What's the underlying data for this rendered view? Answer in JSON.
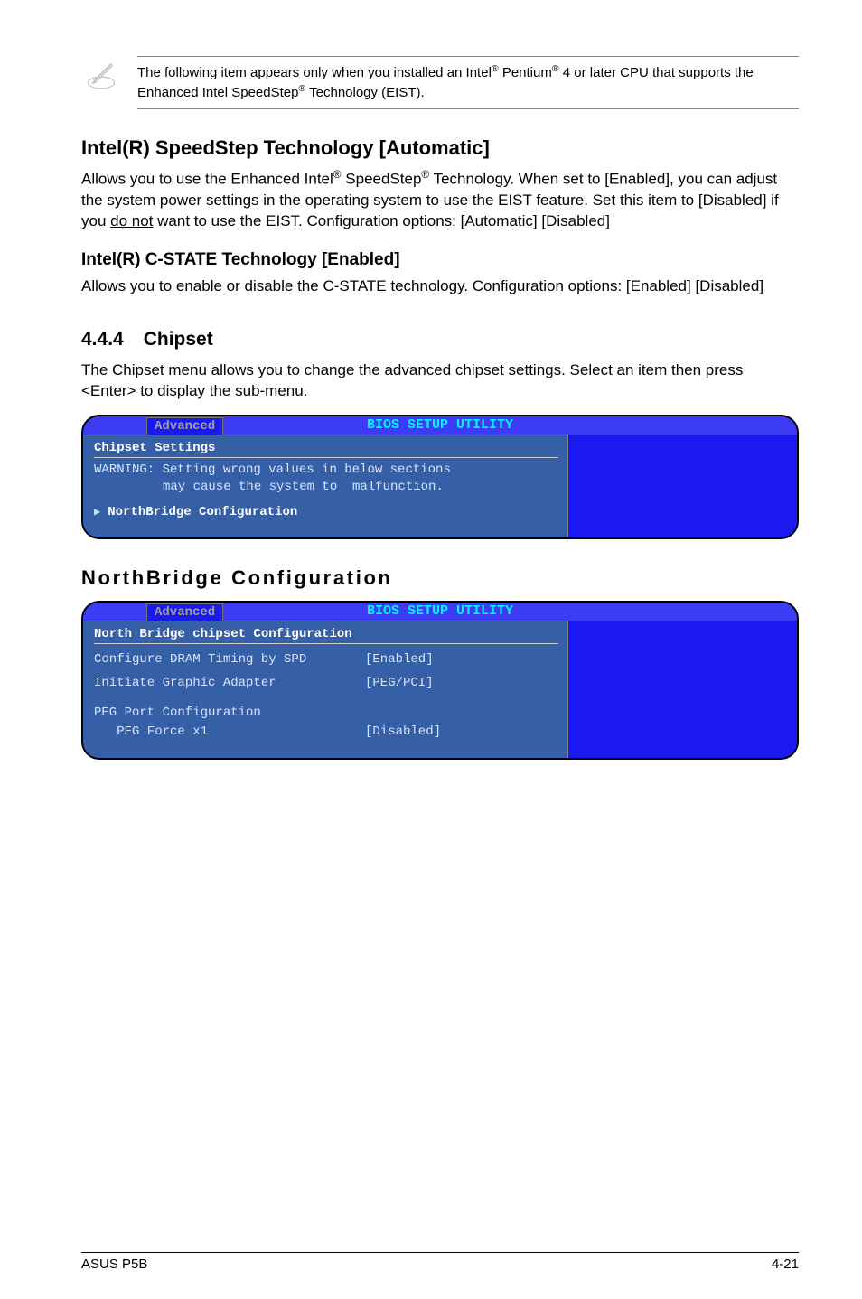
{
  "note": {
    "line1_pre": "The following item appears only when you installed an Intel",
    "line1_mid": " Pentium",
    "line1_post": " 4 or later CPU that supports the Enhanced Intel SpeedStep",
    "line1_end": " Technology (EIST)."
  },
  "speedstep": {
    "heading": "Intel(R) SpeedStep Technology [Automatic]",
    "body_pre": "Allows you to use the Enhanced Intel",
    "body_mid": " SpeedStep",
    "body_post": " Technology. When set to [Enabled], you can adjust the system power settings in the operating system to use the EIST feature. Set this item to [Disabled] if you ",
    "body_underline": "do not",
    "body_after": " want to use the EIST. Configuration options: [Automatic] [Disabled]"
  },
  "cstate": {
    "heading": "Intel(R) C-STATE Technology [Enabled]",
    "body": "Allows you to enable or disable the C-STATE technology. Configuration options: [Enabled] [Disabled]"
  },
  "chipset": {
    "num": "4.4.4",
    "title": "Chipset",
    "body": "The Chipset menu allows you to change the advanced chipset settings. Select an item then press <Enter> to display the sub-menu."
  },
  "bios": {
    "title": "BIOS SETUP UTILITY",
    "tab": "Advanced"
  },
  "bios1": {
    "section": "Chipset Settings",
    "warn1": "WARNING: Setting wrong values in below sections",
    "warn2": "may cause the system to  malfunction.",
    "item": "NorthBridge Configuration"
  },
  "nb_heading": "NorthBridge Configuration",
  "bios2": {
    "section": "North Bridge chipset Configuration",
    "rows": [
      {
        "k": "Configure DRAM Timing by SPD",
        "v": "[Enabled]"
      },
      {
        "k": "Initiate Graphic Adapter",
        "v": "[PEG/PCI]"
      },
      {
        "k": "PEG Port Configuration",
        "v": ""
      },
      {
        "k": "   PEG Force x1",
        "v": "[Disabled]"
      }
    ]
  },
  "footer": {
    "left": "ASUS P5B",
    "right": "4-21"
  }
}
